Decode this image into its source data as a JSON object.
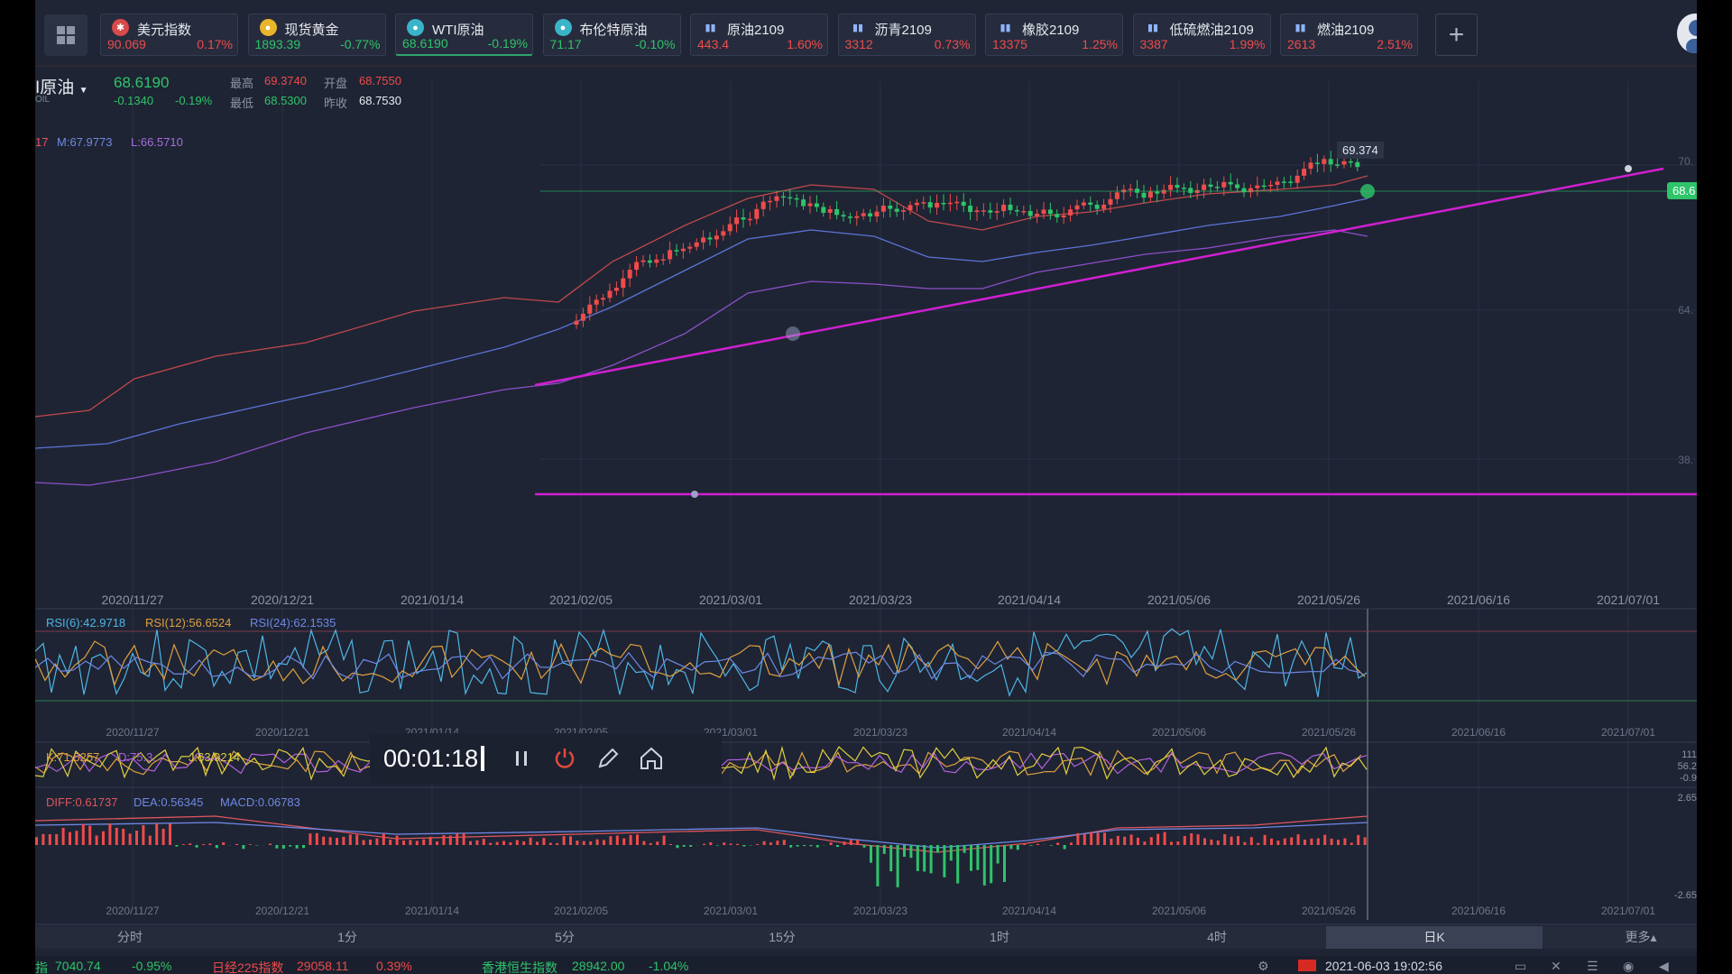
{
  "tickers": [
    {
      "name": "美元指数",
      "price": "90.069",
      "pct": "0.17%",
      "dir": "up",
      "icon": "us-flag-icon"
    },
    {
      "name": "现货黄金",
      "price": "1893.39",
      "pct": "-0.77%",
      "dir": "down",
      "icon": "gold-icon"
    },
    {
      "name": "WTI原油",
      "price": "68.6190",
      "pct": "-0.19%",
      "dir": "down",
      "icon": "oil-drop-icon",
      "active": true
    },
    {
      "name": "布伦特原油",
      "price": "71.17",
      "pct": "-0.10%",
      "dir": "down",
      "icon": "oil-drop-icon"
    },
    {
      "name": "原油2109",
      "price": "443.4",
      "pct": "1.60%",
      "dir": "up",
      "icon": "bar-chart-icon"
    },
    {
      "name": "沥青2109",
      "price": "3312",
      "pct": "0.73%",
      "dir": "up",
      "icon": "bar-chart-icon"
    },
    {
      "name": "橡胶2109",
      "price": "13375",
      "pct": "1.25%",
      "dir": "up",
      "icon": "bar-chart-icon"
    },
    {
      "name": "低硫燃油2109",
      "price": "3387",
      "pct": "1.99%",
      "dir": "up",
      "icon": "bar-chart-icon"
    },
    {
      "name": "燃油2109",
      "price": "2613",
      "pct": "2.51%",
      "dir": "up",
      "icon": "bar-chart-icon"
    }
  ],
  "quote": {
    "symbol": "I原油",
    "last": "68.6190",
    "change": "-0.1340",
    "change_pct": "-0.19%",
    "sub": "OIL",
    "high_label": "最高",
    "high": "69.3740",
    "low_label": "最低",
    "low": "68.5300",
    "open_label": "开盘",
    "open": "68.7550",
    "prev_label": "昨收",
    "prev": "68.7530"
  },
  "main_indicator": {
    "prefix": "17",
    "m": "M:67.9773",
    "l": "L:66.5710"
  },
  "price_tag": "69.374",
  "price_marker": "68.6",
  "right_axis": [
    "70.",
    "64.",
    "38."
  ],
  "date_axis_main": [
    "2020/11/27",
    "2020/12/21",
    "2021/01/14",
    "2021/02/05",
    "2021/03/01",
    "2021/03/23",
    "2021/04/14",
    "2021/05/06",
    "2021/05/26",
    "2021/06/16",
    "2021/07/01"
  ],
  "date_axis_sub": [
    "2020/11/27",
    "2020/12/21",
    "2021/01/14",
    "2021/02/05",
    "2021/03/01",
    "2021/03/23",
    "2021/04/14",
    "2021/05/06",
    "2021/05/26",
    "2021/06/16",
    "2021/07/01"
  ],
  "rsi": {
    "r6": "RSI(6):42.9718",
    "r12": "RSI(12):56.6524",
    "r24": "RSI(24):62.1535"
  },
  "kdj": {
    "k": "K:71.5257",
    "d": "D:75.3...",
    "j": "J:63.9214",
    "axis": [
      "111",
      "56.2",
      "-0.9"
    ]
  },
  "macd": {
    "diff": "DIFF:0.61737",
    "dea": "DEA:0.56345",
    "macd": "MACD:0.06783",
    "axis": [
      "2.65",
      "-2.65"
    ]
  },
  "recorder": {
    "time": "00:01:18"
  },
  "periods": [
    "分时",
    "1分",
    "5分",
    "15分",
    "1时",
    "4时",
    "日K"
  ],
  "active_period": "日K",
  "more_label": "更多▴",
  "status": {
    "item1_name": "指",
    "item1_value": "7040.74",
    "item1_pct": "-0.95%",
    "item2_name": "日经225指数",
    "item2_value": "29058.11",
    "item2_pct": "0.39%",
    "item3_name": "香港恒生指数",
    "item3_value": "28942.00",
    "item3_pct": "-1.04%",
    "datetime": "2021-06-03 19:02:56"
  },
  "colors": {
    "up": "#ef4b4b",
    "down": "#2ec46a",
    "trendline": "#d01fd0",
    "bg": "#1e2433"
  }
}
